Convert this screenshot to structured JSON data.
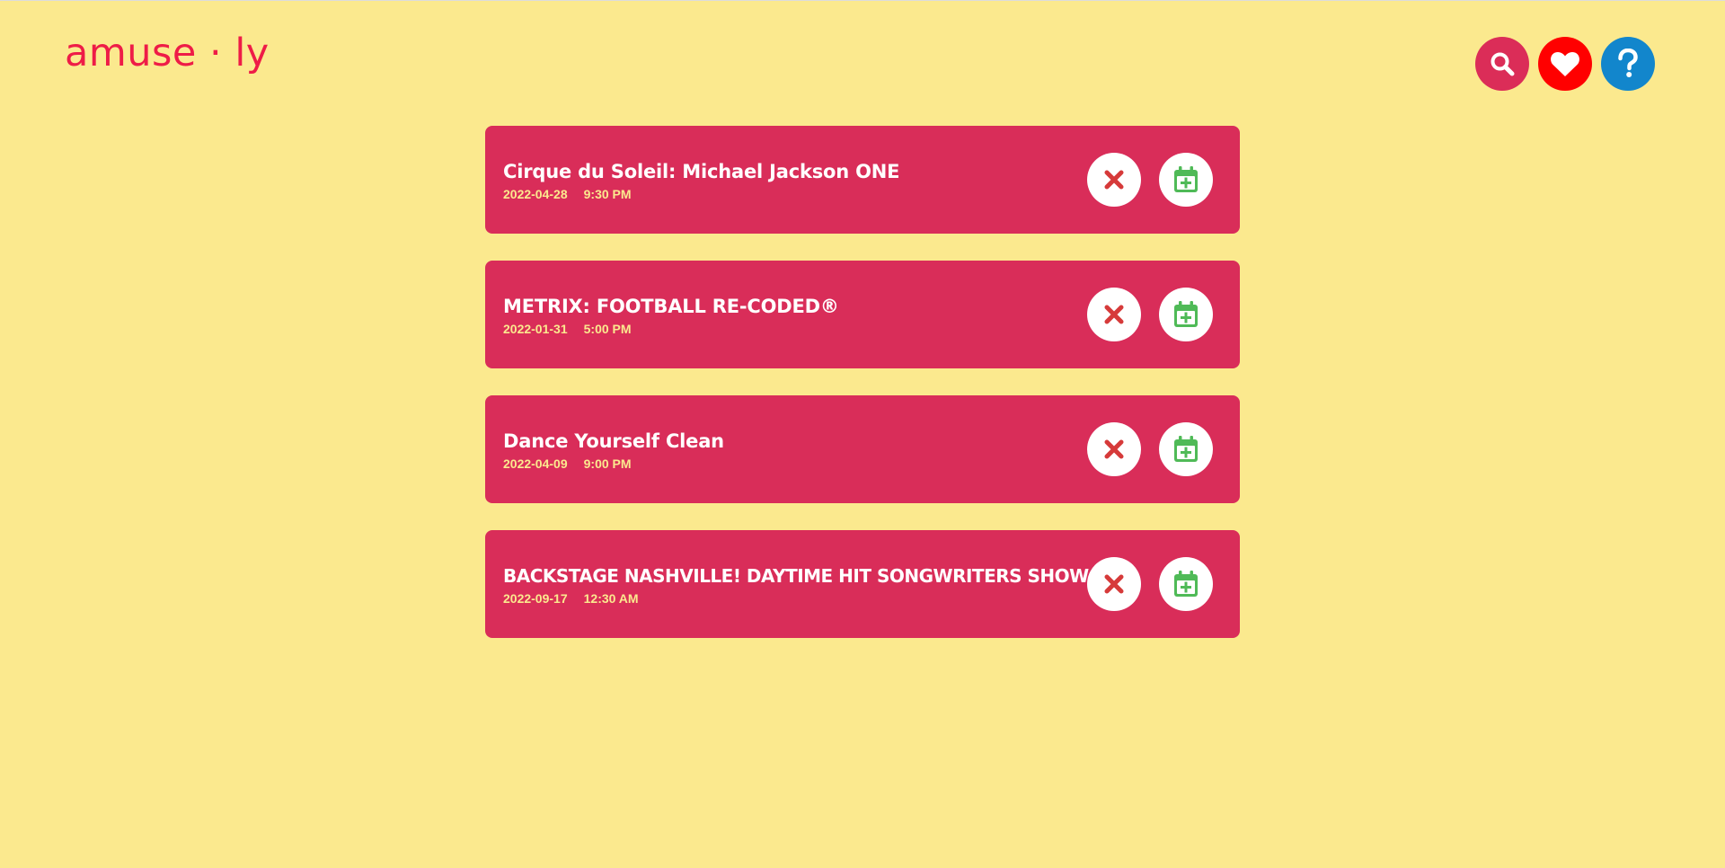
{
  "app": {
    "logo_text": "amuse · ly"
  },
  "nav": {
    "search_icon": "search-icon",
    "favorites_icon": "heart-icon",
    "help_icon": "question-icon"
  },
  "colors": {
    "background": "#fbe98e",
    "brand": "#ee1c47",
    "card": "#d92d59",
    "search_button": "#db2d58",
    "favorites_button": "#ff0000",
    "help_button": "#1286cc",
    "dismiss_icon": "#d63a3a",
    "calendar_icon": "#4fba57"
  },
  "events": [
    {
      "title": "Cirque du Soleil: Michael Jackson ONE",
      "date": "2022-04-28",
      "time": "9:30 PM"
    },
    {
      "title": "METRIX: FOOTBALL RE-CODED®",
      "date": "2022-01-31",
      "time": "5:00 PM"
    },
    {
      "title": "Dance Yourself Clean",
      "date": "2022-04-09",
      "time": "9:00 PM"
    },
    {
      "title": "BACKSTAGE NASHVILLE! DAYTIME HIT SONGWRITERS SHOW",
      "date": "2022-09-17",
      "time": "12:30 AM"
    }
  ],
  "actions": {
    "dismiss_icon": "close-icon",
    "add_icon": "calendar-plus-icon"
  }
}
